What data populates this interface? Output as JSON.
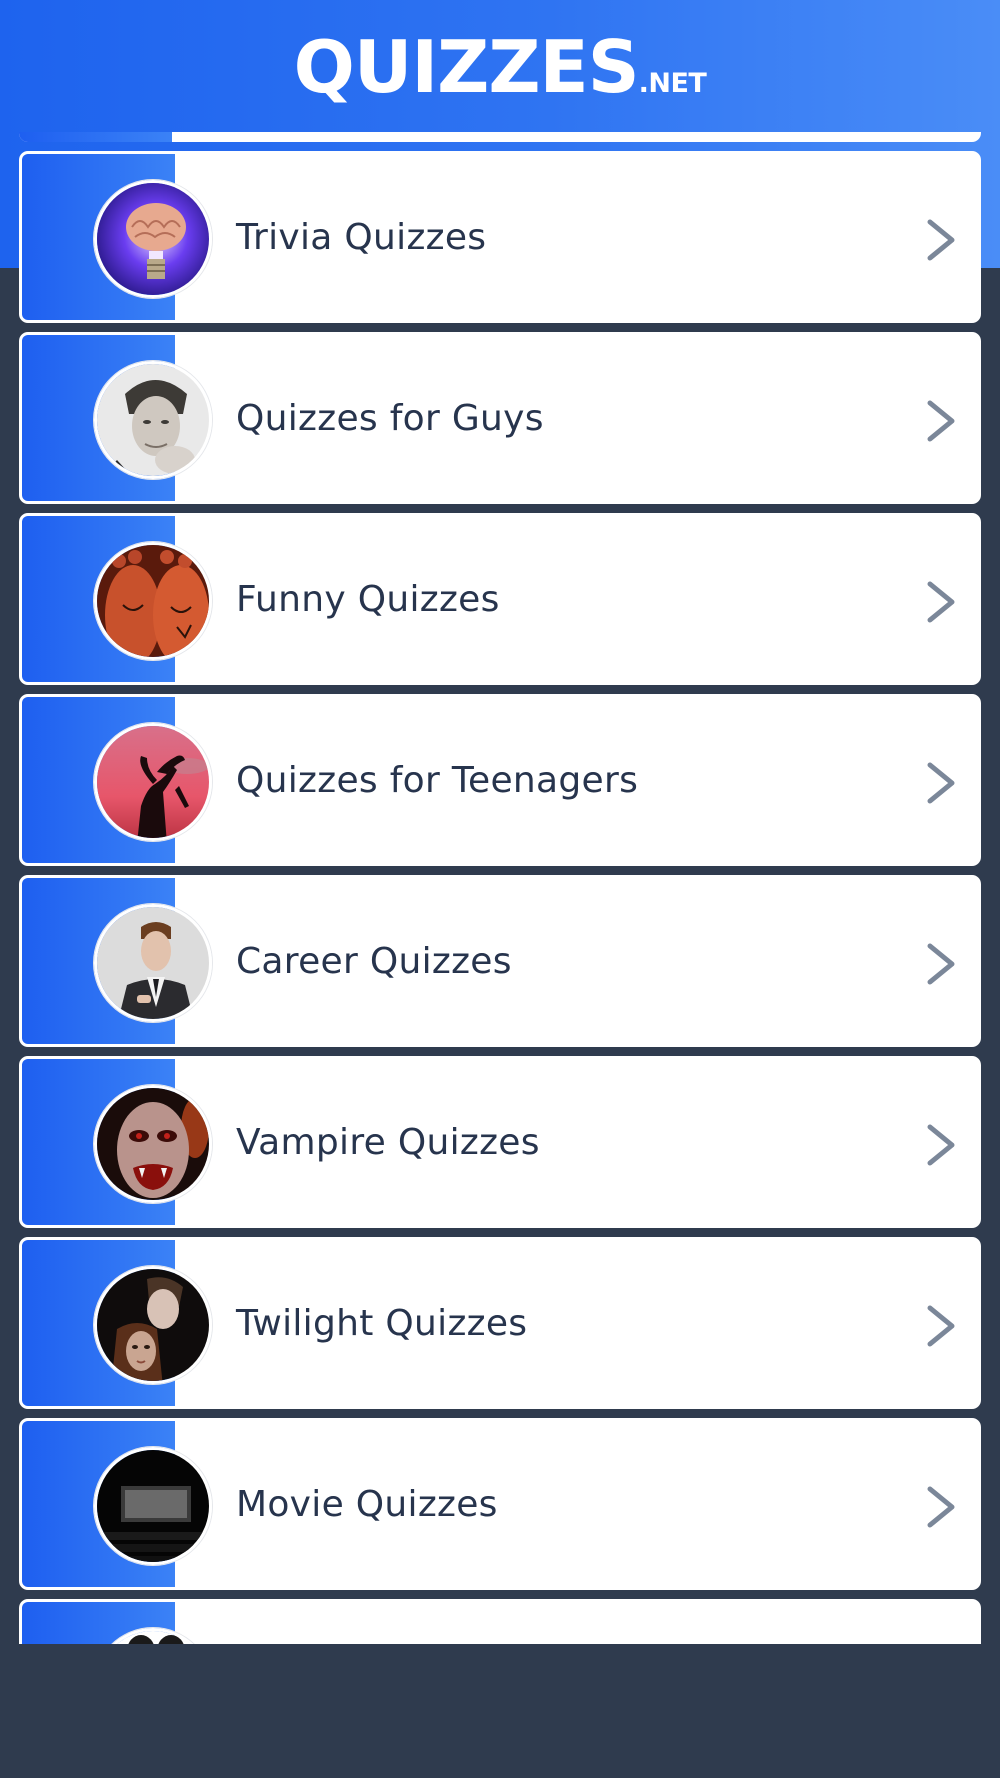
{
  "header": {
    "logo_main": "QUIZZES",
    "logo_suffix": ".NET"
  },
  "categories": [
    {
      "label": "Trivia Quizzes",
      "icon": "brain-lightbulb-image"
    },
    {
      "label": "Quizzes for Guys",
      "icon": "man-portrait-image"
    },
    {
      "label": "Funny Quizzes",
      "icon": "painted-feet-image"
    },
    {
      "label": "Quizzes for Teenagers",
      "icon": "dancing-silhouette-image"
    },
    {
      "label": "Career Quizzes",
      "icon": "businessman-image"
    },
    {
      "label": "Vampire Quizzes",
      "icon": "vampire-face-image"
    },
    {
      "label": "Twilight Quizzes",
      "icon": "twilight-couple-image"
    },
    {
      "label": "Movie Quizzes",
      "icon": "movie-theater-image"
    }
  ],
  "colors": {
    "brand_blue": "#1e63ee",
    "background": "#2f3b4e",
    "label_text": "#27344d",
    "arrow": "#7b8799"
  }
}
